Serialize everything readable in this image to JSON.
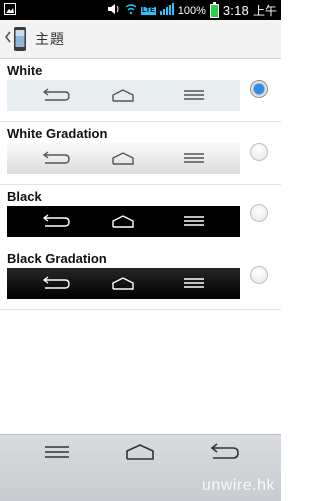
{
  "status_bar": {
    "time": "3:18",
    "ampm": "上午",
    "battery_percent": "100%",
    "network_label": "LTE",
    "icons": [
      "gallery-notification-icon",
      "speaker-icon",
      "wifi-icon",
      "lte-icon",
      "signal-icon",
      "battery-icon"
    ]
  },
  "header": {
    "back_icon": "chevron-left-icon",
    "app_icon": "phone-theme-icon",
    "title": "主題"
  },
  "themes": [
    {
      "name": "White",
      "style": "white",
      "selected": true
    },
    {
      "name": "White Gradation",
      "style": "white-gradation",
      "selected": false
    },
    {
      "name": "Black",
      "style": "black",
      "selected": false
    },
    {
      "name": "Black Gradation",
      "style": "black-gradation",
      "selected": false
    }
  ],
  "preview_buttons": [
    "back-icon",
    "home-icon",
    "menu-icon"
  ],
  "bottom_nav": {
    "buttons": [
      "menu-icon",
      "home-icon",
      "back-icon"
    ]
  },
  "watermark": "unwire.hk",
  "colors": {
    "radio_selected": "#2f8fe0",
    "battery": "#27d14a",
    "lte": "#29c4ff"
  }
}
